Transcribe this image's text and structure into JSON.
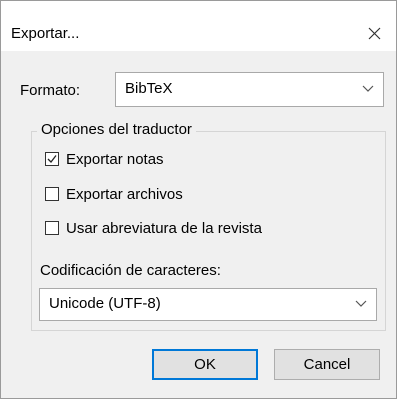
{
  "window": {
    "title": "Exportar..."
  },
  "format": {
    "label": "Formato:",
    "value": "BibTeX"
  },
  "translator_options": {
    "title": "Opciones del traductor",
    "options": [
      {
        "label": "Exportar notas",
        "checked": true
      },
      {
        "label": "Exportar archivos",
        "checked": false
      },
      {
        "label": "Usar abreviatura de la revista",
        "checked": false
      }
    ]
  },
  "encoding": {
    "label": "Codificación de caracteres:",
    "value": "Unicode (UTF-8)"
  },
  "buttons": {
    "ok": "OK",
    "cancel": "Cancel"
  },
  "colors": {
    "accent": "#0078d7",
    "dialog_bg": "#f0f0f0"
  },
  "icons": {
    "close": "close-icon",
    "dropdown": "chevron-down-icon",
    "check": "checkmark-icon"
  }
}
